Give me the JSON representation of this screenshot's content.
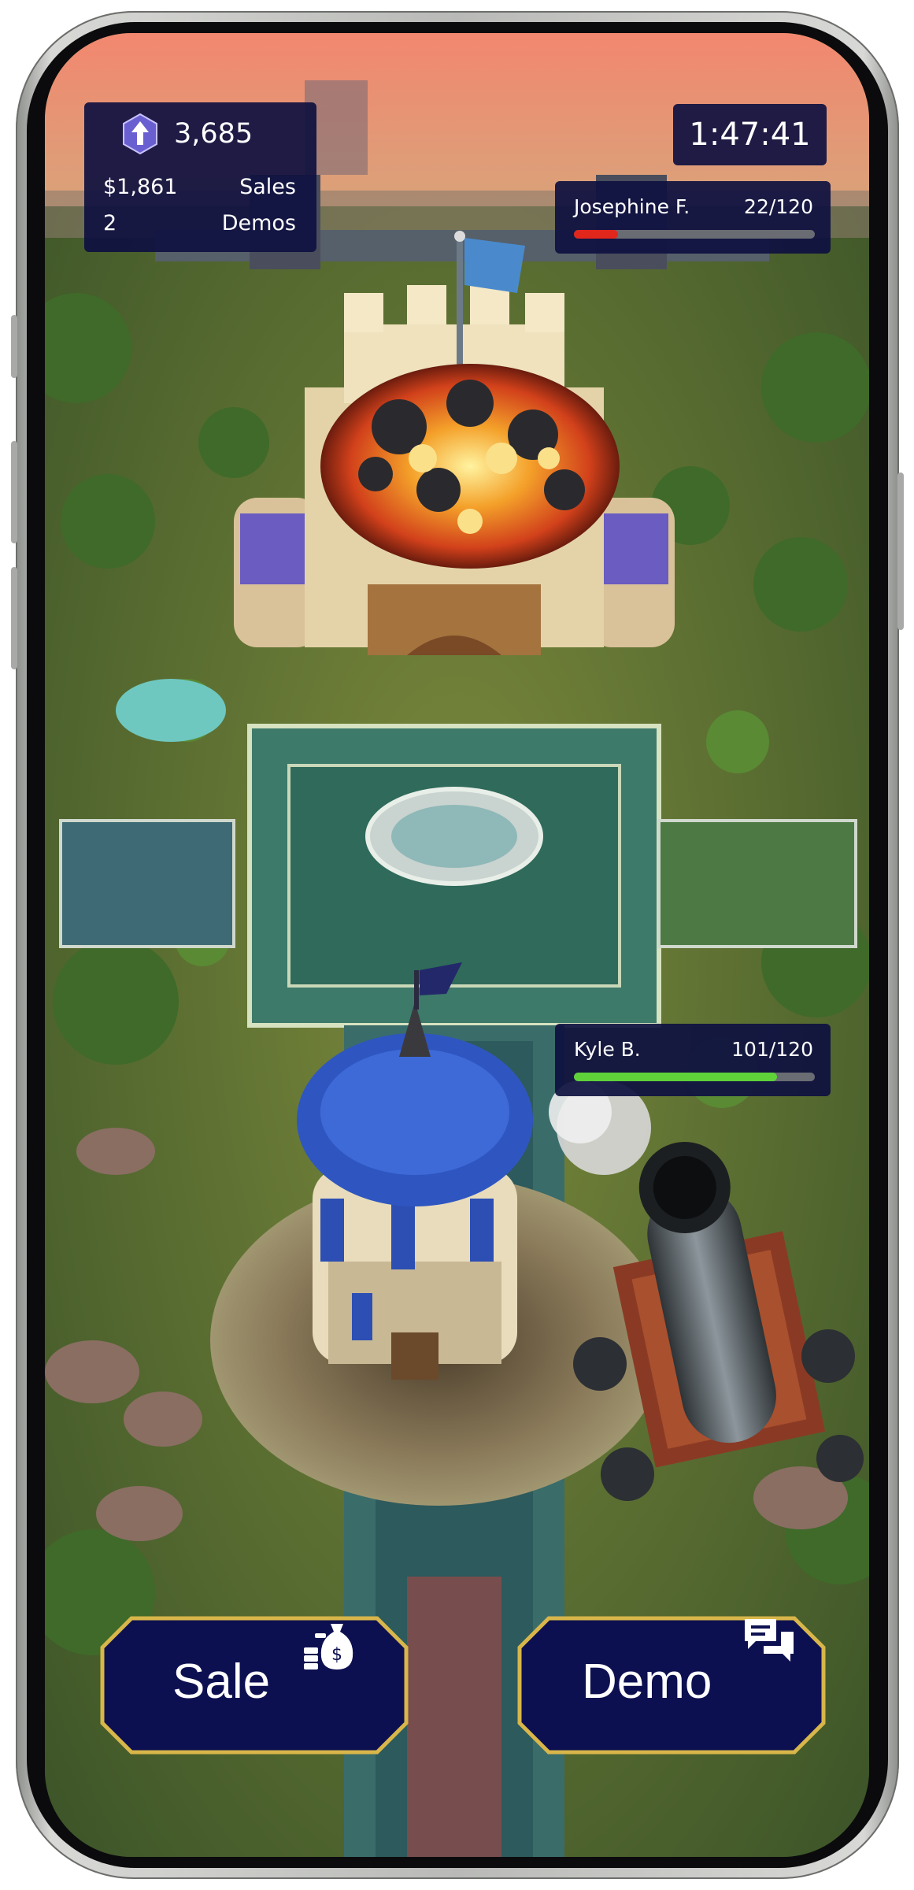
{
  "hud": {
    "gems": "3,685",
    "sales_amount": "$1,861",
    "sales_label": "Sales",
    "demos_count": "2",
    "demos_label": "Demos",
    "timer": "1:47:41"
  },
  "enemy": {
    "name": "Josephine F.",
    "hp_text": "22/120",
    "hp_fraction": 0.183,
    "bar_color": "#e1261c"
  },
  "player": {
    "name": "Kyle B.",
    "hp_text": "101/120",
    "hp_fraction": 0.842,
    "bar_color": "#5fd23a"
  },
  "actions": {
    "sale_label": "Sale",
    "demo_label": "Demo"
  },
  "icons": {
    "gem": "gem-upgrade-icon",
    "sale": "money-bag-icon",
    "demo": "chat-bubbles-icon"
  },
  "colors": {
    "panel_bg": "#0e1040",
    "button_bg": "#0d1050",
    "button_border": "#d8b64a",
    "sky": "#f08a74"
  }
}
